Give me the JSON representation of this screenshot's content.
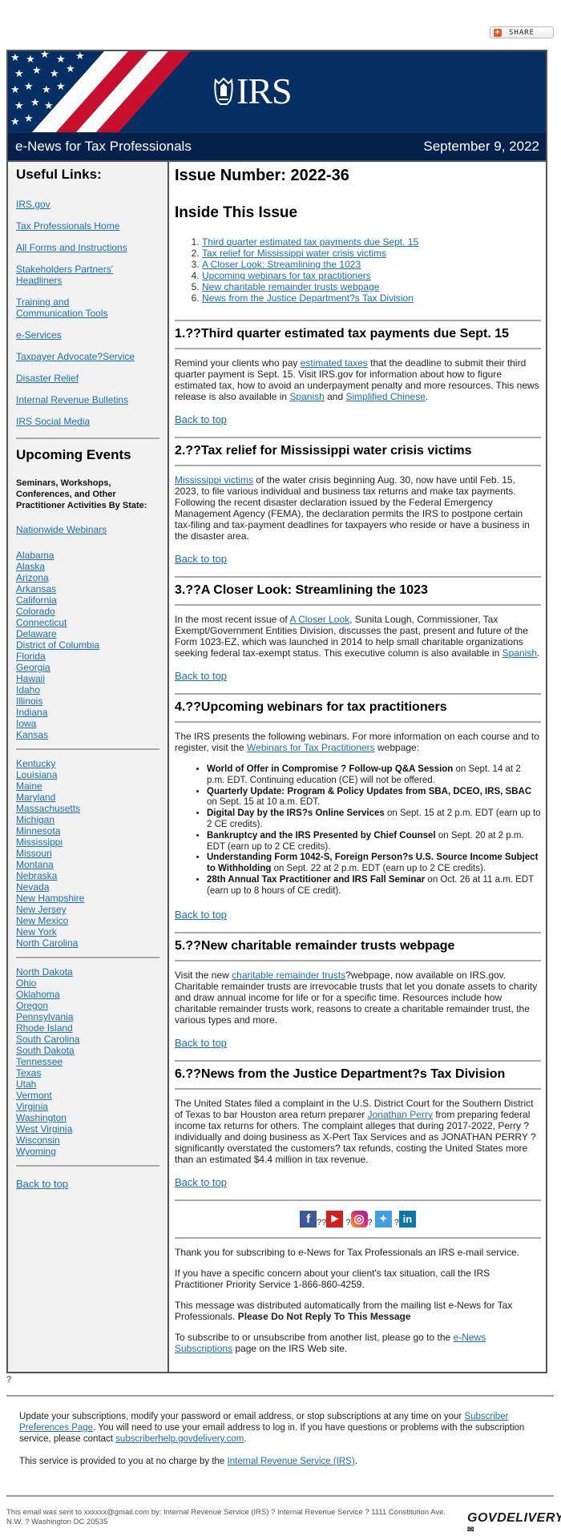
{
  "share": {
    "label": "SHARE"
  },
  "header": {
    "logo_text": "IRS",
    "title": "e-News for Tax Professionals",
    "date": "September 9, 2022",
    "colors": {
      "banner": "#052e63",
      "titlebar": "#03214a",
      "flag_red": "#c8102e"
    }
  },
  "sidebar": {
    "useful_links_title": "Useful Links:",
    "useful_links": [
      "IRS.gov",
      "Tax Professionals Home",
      "All Forms and Instructions",
      "Stakeholders Partners' Headliners",
      "Training and Communication Tools",
      "e-Services",
      "Taxpayer Advocate?Service",
      "Disaster Relief",
      "Internal Revenue Bulletins",
      "IRS Social Media"
    ],
    "events_title": "Upcoming Events",
    "events_subtitle": "Seminars, Workshops, Conferences, and Other Practitioner Activities By State:",
    "nationwide": "Nationwide Webinars",
    "states_group1": [
      "Alabama",
      "Alaska",
      "Arizona",
      "Arkansas",
      "California",
      "Colorado",
      "Connecticut",
      "Delaware",
      "District of Columbia",
      "Florida",
      "Georgia",
      "Hawaii",
      "Idaho",
      "Illinois",
      "Indiana",
      "Iowa",
      "Kansas"
    ],
    "states_group2": [
      "Kentucky",
      "Louisiana",
      "Maine",
      "Maryland",
      "Massachusetts",
      "Michigan",
      "Minnesota",
      "Mississippi",
      "Missouri",
      "Montana",
      "Nebraska",
      "Nevada",
      "New Hampshire",
      "New Jersey",
      "New Mexico",
      "New York",
      "North Carolina"
    ],
    "states_group3": [
      "North Dakota",
      "Ohio",
      "Oklahoma",
      "Oregon",
      "Pennsylvania",
      "Rhode Island",
      "South Carolina",
      "South Dakota",
      "Tennessee",
      "Texas",
      "Utah",
      "Vermont",
      "Virginia",
      "Washington",
      "West Virginia",
      "Wisconsin",
      "Wyoming"
    ],
    "back_to_top": "Back to top"
  },
  "main": {
    "issue_number": "Issue Number: 2022-36",
    "inside_title": "Inside This Issue",
    "toc": [
      "Third quarter estimated tax payments due Sept. 15",
      "Tax relief for Mississippi water crisis victims",
      "A Closer Look: Streamlining the 1023",
      "Upcoming webinars for tax practitioners",
      "New charitable remainder trusts webpage",
      "News from the Justice Department?s Tax Division"
    ],
    "back_to_top": "Back to top",
    "s1": {
      "title": "1.??Third quarter estimated tax payments due Sept. 15",
      "t1": "Remind your clients who pay ",
      "link1": "estimated taxes",
      "t2": " that the deadline to submit their third quarter payment is Sept. 15. Visit IRS.gov for information about how to figure estimated tax, how to avoid an underpayment penalty and more resources. This news release is also available in ",
      "link2": "Spanish",
      "t3": " and ",
      "link3": "Simplified Chinese",
      "t4": "."
    },
    "s2": {
      "title": "2.??Tax relief for Mississippi water crisis victims",
      "link1": "Mississippi victims",
      "t1": " of the water crisis beginning Aug. 30, now have until Feb. 15, 2023, to file various individual and business tax returns and make tax payments. Following the recent disaster declaration issued by the Federal Emergency Management Agency (FEMA), the declaration permits the IRS to postpone certain tax-filing and tax-payment deadlines for taxpayers who reside or have a business in the disaster area."
    },
    "s3": {
      "title": "3.??A Closer Look: Streamlining the 1023",
      "t1": "In the most recent issue of ",
      "link1": "A Closer Look",
      "t2": ", Sunita Lough, Commissioner, Tax Exempt/Government Entities Division, discusses the past, present and future of the Form 1023-EZ, which was launched in 2014 to help small charitable organizations seeking federal tax-exempt status. This executive column is also available in ",
      "link2": "Spanish",
      "t3": "."
    },
    "s4": {
      "title": "4.??Upcoming webinars for tax practitioners",
      "t1": "The IRS presents the following webinars. For more information on each course and to register, visit the ",
      "link1": "Webinars for Tax Practitioners",
      "t2": " webpage:",
      "webinars": [
        {
          "name": "World of Offer in Compromise ? Follow-up Q&A Session",
          "detail": " on Sept. 14 at 2 p.m. EDT. Continuing education (CE) will not be offered."
        },
        {
          "name": "Quarterly Update: Program & Policy Updates from SBA, DCEO, IRS, SBAC",
          "detail": " on Sept. 15 at 10 a.m. EDT."
        },
        {
          "name": "Digital Day by the IRS?s Online Services",
          "detail": " on Sept. 15 at 2 p.m. EDT (earn up to 2 CE credits)."
        },
        {
          "name": "Bankruptcy and the IRS Presented by Chief Counsel",
          "detail": " on Sept. 20 at 2 p.m. EDT (earn up to 2 CE credits)."
        },
        {
          "name": "Understanding Form 1042-S, Foreign Person?s U.S. Source Income Subject to Withholding",
          "detail": " on Sept. 22 at 2 p.m. EDT (earn up to 2 CE credits)."
        },
        {
          "name": "28th Annual Tax Practitioner and IRS Fall Seminar",
          "detail": " on Oct. 26 at 11 a.m. EDT (earn up to 8 hours of CE credit)."
        }
      ]
    },
    "s5": {
      "title": "5.??New charitable remainder trusts webpage",
      "t1": "Visit the new ",
      "link1": "charitable remainder trusts",
      "t2": "?webpage, now available on IRS.gov. Charitable remainder trusts are irrevocable trusts that let you donate assets to charity and draw annual income for life or for a specific time. Resources include how charitable remainder trusts work, reasons to create a charitable remainder trust, the various types and more."
    },
    "s6": {
      "title": "6.??News from the Justice Department?s Tax Division",
      "t1": "The United States filed a complaint in the U.S. District Court for the Southern District of Texas to bar Houston area return preparer ",
      "link1": "Jonathan Perry",
      "t2": " from preparing federal income tax returns for others. The complaint alleges that during 2017-2022, Perry ? individually and doing business as X-Pert Tax Services and as JONATHAN PERRY ? significantly overstated the customers? tax refunds, costing the United States more than an estimated $4.4 million in tax revenue."
    },
    "social": {
      "icons": [
        "facebook-icon",
        "youtube-icon",
        "instagram-icon",
        "twitter-icon",
        "linkedin-icon"
      ],
      "glyphs": {
        "facebook": "f",
        "youtube": "▶",
        "instagram": "◎",
        "twitter": "✦",
        "linkedin": "in"
      },
      "sep1": "??",
      "sep": "?",
      "colors": {
        "facebook": "#3b5998",
        "youtube": "#cd201f",
        "instagram": "#e1306c",
        "twitter": "#3fa1e0",
        "linkedin": "#0e76a8"
      }
    },
    "footer": {
      "p1": "Thank you for subscribing to e-News for Tax Professionals an IRS e-mail service.",
      "p2": "If you have a specific concern about your client's tax situation, call the IRS Practitioner Priority Service 1-866-860-4259.",
      "p3": "This message was distributed automatically from the mailing list e-News for Tax Professionals. ",
      "p3_bold": "Please Do Not Reply To This Message",
      "p4a": "To subscribe to or unsubscribe from another list, please go to the ",
      "p4_link": "e-News Subscriptions",
      "p4b": " page on the IRS Web site."
    }
  },
  "page_footer": {
    "question": "?",
    "sub_t1": "Update your subscriptions, modify your password or email address, or stop subscriptions at any time on your ",
    "sub_link1": "Subscriber Preferences Page",
    "sub_t2": ". You will need to use your email address to log in. If you have questions or problems with the subscription service, please contact ",
    "sub_link2": "subscriberhelp.govdelivery.com",
    "sub_t3": ".",
    "free_t1": "This service is provided to you at no charge by the ",
    "free_link": "Internal Revenue Service (IRS)",
    "free_t2": ".",
    "sent_to": "This email was sent to xxxxxx@gmail.com by: Internal Revenue Service (IRS) ? Internal Revenue Service ? 1111 Constitution Ave. N.W. ? Washington DC 20535",
    "govdelivery": "GOVDELIVERY"
  }
}
